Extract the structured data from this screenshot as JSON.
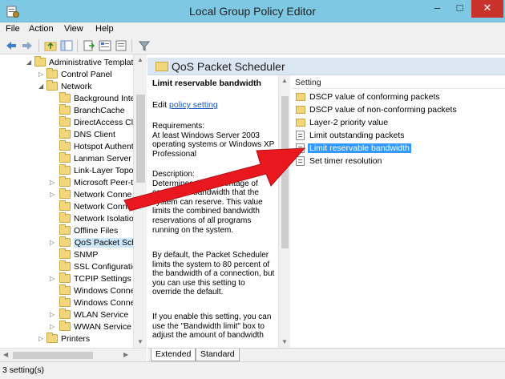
{
  "window": {
    "title": "Local Group Policy Editor",
    "min": "–",
    "max": "□",
    "close": "✕"
  },
  "menu": {
    "file": "File",
    "action": "Action",
    "view": "View",
    "help": "Help"
  },
  "tree": {
    "items": [
      {
        "label": "Administrative Templat",
        "expanded": true
      },
      {
        "label": "Control Panel",
        "expanded": false
      },
      {
        "label": "Network",
        "expanded": true
      },
      {
        "label": "Background Inte"
      },
      {
        "label": "BranchCache"
      },
      {
        "label": "DirectAccess Clie"
      },
      {
        "label": "DNS Client"
      },
      {
        "label": "Hotspot Authent"
      },
      {
        "label": "Lanman Server"
      },
      {
        "label": "Link-Layer Topo"
      },
      {
        "label": "Microsoft Peer-t"
      },
      {
        "label": "Network Conne"
      },
      {
        "label": "Network Connect"
      },
      {
        "label": "Network Isolatio"
      },
      {
        "label": "Offline Files"
      },
      {
        "label": "QoS Packet Sche",
        "selected": true
      },
      {
        "label": "SNMP"
      },
      {
        "label": "SSL Configuratio"
      },
      {
        "label": "TCPIP Settings"
      },
      {
        "label": "Windows Conne"
      },
      {
        "label": "Windows Conne"
      },
      {
        "label": "WLAN Service"
      },
      {
        "label": "WWAN Service"
      },
      {
        "label": "Printers"
      }
    ]
  },
  "header": {
    "title": "QoS Packet Scheduler"
  },
  "description": {
    "heading": "Limit reservable bandwidth",
    "edit_prefix": "Edit ",
    "edit_link": "policy setting",
    "requirements": "Requirements:\nAt least Windows Server 2003 operating systems or Windows XP Professional",
    "description": "Description:\nDetermines the percentage of connection bandwidth that the system can reserve. This value limits the combined bandwidth reservations of all programs running on the system.",
    "para2": "By default, the Packet Scheduler limits the system to 80 percent of the bandwidth of a connection, but you can use this setting to override the default.",
    "para3": "If you enable this setting, you can use the \"Bandwidth limit\" box to adjust the amount of bandwidth"
  },
  "settings": {
    "column_header": "Setting",
    "rows": [
      {
        "label": "DSCP value of conforming packets",
        "type": "folder"
      },
      {
        "label": "DSCP value of non-conforming packets",
        "type": "folder"
      },
      {
        "label": "Layer-2 priority value",
        "type": "folder"
      },
      {
        "label": "Limit outstanding packets",
        "type": "setting"
      },
      {
        "label": "Limit reservable bandwidth",
        "type": "setting",
        "selected": true
      },
      {
        "label": "Set timer resolution",
        "type": "setting"
      }
    ]
  },
  "tabs": {
    "extended": "Extended",
    "standard": "Standard"
  },
  "status": {
    "text": "3 setting(s)"
  },
  "colors": {
    "titlebar": "#7ec8e3",
    "selection": "#3399ff",
    "arrow": "#e8181e",
    "close": "#c7322b"
  }
}
